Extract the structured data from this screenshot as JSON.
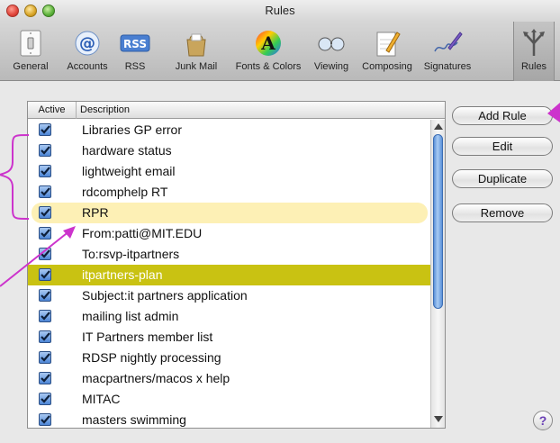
{
  "window": {
    "title": "Rules"
  },
  "toolbar": {
    "items": [
      {
        "label": "General",
        "icon": "light-switch-icon"
      },
      {
        "label": "Accounts",
        "icon": "at-sign-icon"
      },
      {
        "label": "RSS",
        "icon": "rss-badge-icon"
      },
      {
        "label": "Junk Mail",
        "icon": "junk-mail-bag-icon"
      },
      {
        "label": "Fonts & Colors",
        "icon": "fonts-colors-icon"
      },
      {
        "label": "Viewing",
        "icon": "glasses-icon"
      },
      {
        "label": "Composing",
        "icon": "pencil-pad-icon"
      },
      {
        "label": "Signatures",
        "icon": "signature-pen-icon"
      },
      {
        "label": "Rules",
        "icon": "rules-arrows-icon",
        "selected": true
      }
    ]
  },
  "rules_table": {
    "columns": {
      "active": "Active",
      "description": "Description"
    },
    "rows": [
      {
        "description": "Libraries GP error",
        "active": true
      },
      {
        "description": "hardware status",
        "active": true
      },
      {
        "description": "lightweight email",
        "active": true
      },
      {
        "description": "rdcomphelp RT",
        "active": true
      },
      {
        "description": "RPR",
        "active": true,
        "state": "pale-highlight"
      },
      {
        "description": "From:patti@MIT.EDU",
        "active": true
      },
      {
        "description": "To:rsvp-itpartners",
        "active": true
      },
      {
        "description": "itpartners-plan",
        "active": true,
        "state": "selected"
      },
      {
        "description": "Subject:it partners application",
        "active": true
      },
      {
        "description": "mailing list admin",
        "active": true
      },
      {
        "description": "IT Partners member list",
        "active": true
      },
      {
        "description": "RDSP nightly processing",
        "active": true
      },
      {
        "description": "macpartners/macos x help",
        "active": true
      },
      {
        "description": "MITAC",
        "active": true
      },
      {
        "description": "masters swimming",
        "active": true
      }
    ]
  },
  "buttons": {
    "add_rule": "Add Rule",
    "edit": "Edit",
    "duplicate": "Duplicate",
    "remove": "Remove",
    "help": "?"
  },
  "colors": {
    "selected_row": "#c9c212",
    "pale_highlight": "#fdf0b5",
    "annotation": "#cc33cc",
    "checkbox": "#4d86d6"
  }
}
